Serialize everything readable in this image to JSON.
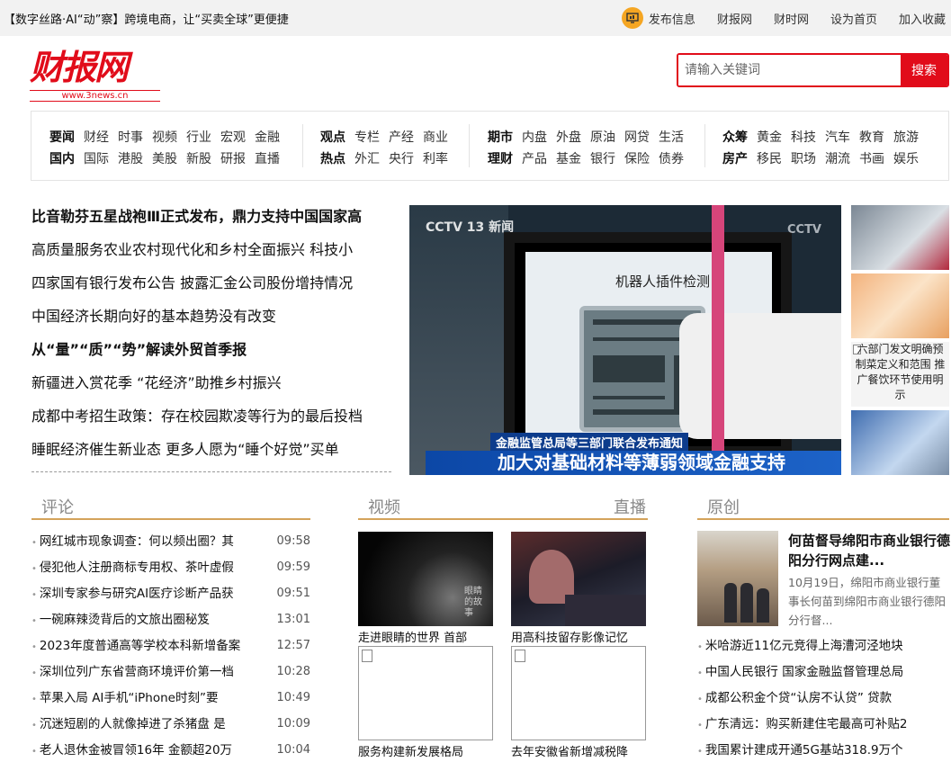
{
  "topbar": {
    "promo": "【数字丝路·AI“动”察】跨境电商，让“买卖全球”更便捷",
    "links": [
      "发布信息",
      "财报网",
      "财时网",
      "设为首页",
      "加入收藏"
    ]
  },
  "logo": {
    "text": "财报网",
    "url": "www.3news.cn"
  },
  "search": {
    "placeholder": "请输入关键词",
    "button": "搜索"
  },
  "nav": [
    {
      "rows": [
        {
          "bold": "要闻",
          "items": [
            "财经",
            "时事",
            "视频",
            "行业",
            "宏观",
            "金融"
          ]
        },
        {
          "bold": "国内",
          "items": [
            "国际",
            "港股",
            "美股",
            "新股",
            "研报",
            "直播"
          ]
        }
      ]
    },
    {
      "rows": [
        {
          "bold": "观点",
          "items": [
            "专栏",
            "产经",
            "商业"
          ]
        },
        {
          "bold": "热点",
          "items": [
            "外汇",
            "央行",
            "利率"
          ]
        }
      ]
    },
    {
      "rows": [
        {
          "bold": "期市",
          "items": [
            "内盘",
            "外盘",
            "原油",
            "网贷",
            "生活"
          ]
        },
        {
          "bold": "理财",
          "items": [
            "产品",
            "基金",
            "银行",
            "保险",
            "债券"
          ]
        }
      ]
    },
    {
      "rows": [
        {
          "bold": "众筹",
          "items": [
            "黄金",
            "科技",
            "汽车",
            "教育",
            "旅游"
          ]
        },
        {
          "bold": "房产",
          "items": [
            "移民",
            "职场",
            "潮流",
            "书画",
            "娱乐"
          ]
        }
      ]
    }
  ],
  "headlines": [
    {
      "text": "比音勒芬五星战袍Ⅲ正式发布，鼎力支持中国国家高",
      "bold": true
    },
    {
      "text": "高质量服务农业农村现代化和乡村全面振兴 科技小",
      "bold": false
    },
    {
      "text": "四家国有银行发布公告 披露汇金公司股份增持情况",
      "bold": false
    },
    {
      "text": "中国经济长期向好的基本趋势没有改变",
      "bold": false
    },
    {
      "text": "从“量”“质”“势”解读外贸首季报",
      "bold": true
    },
    {
      "text": "新疆进入赏花季 “花经济”助推乡村振兴",
      "bold": false
    },
    {
      "text": "成都中考招生政策：存在校园欺凌等行为的最后投档",
      "bold": false
    },
    {
      "text": "睡眠经济催生新业态 更多人愿为“睡个好觉”买单",
      "bold": false
    }
  ],
  "hero": {
    "channel": "CCTV 13 新闻",
    "watermark": "CCTV",
    "screen_caption": "机器人插件检测",
    "ticker_top": "金融监管总局等三部门联合发布通知",
    "ticker": "加大对基础材料等薄弱领域金融支持"
  },
  "thumbs": {
    "alt3": "六部门发文明确预制菜定义和范围 推广餐饮环节使用明示"
  },
  "sections": {
    "comment": "评论",
    "video": "视频",
    "live": "直播",
    "original": "原创"
  },
  "comments": [
    {
      "text": "网红城市现象调查：何以频出圈？其",
      "time": "09:58"
    },
    {
      "text": "侵犯他人注册商标专用权、茶叶虚假",
      "time": "09:59"
    },
    {
      "text": "深圳专家参与研究AI医疗诊断产品获",
      "time": "09:51"
    },
    {
      "text": "一碗麻辣烫背后的文旅出圈秘笈",
      "time": "13:01"
    },
    {
      "text": "2023年度普通高等学校本科新增备案",
      "time": "12:57"
    },
    {
      "text": "深圳位列广东省营商环境评价第一档",
      "time": "10:28"
    },
    {
      "text": "苹果入局 AI手机“iPhone时刻”要",
      "time": "10:49"
    },
    {
      "text": "沉迷短剧的人就像掉进了杀猪盘 是",
      "time": "10:09"
    },
    {
      "text": "老人退休金被冒领16年 金额超20万",
      "time": "10:04"
    }
  ],
  "videos": [
    {
      "caption": "走进眼睛的世界 首部",
      "overlay": "眼睛 的故事"
    },
    {
      "caption": "用高科技留存影像记忆"
    },
    {
      "caption": "服务构建新发展格局"
    },
    {
      "caption": "去年安徽省新增减税降"
    }
  ],
  "original": {
    "title": "何苗督导绵阳市商业银行德阳分行网点建...",
    "desc": "10月19日，绵阳市商业银行董事长何苗到绵阳市商业银行德阳分行督...",
    "items": [
      "米哈游近11亿元竞得上海漕河泾地块",
      "中国人民银行 国家金融监督管理总局",
      "成都公积金个贷“认房不认贷” 贷款",
      "广东清远：购买新建住宅最高可补贴2",
      "我国累计建成开通5G基站318.9万个"
    ]
  }
}
